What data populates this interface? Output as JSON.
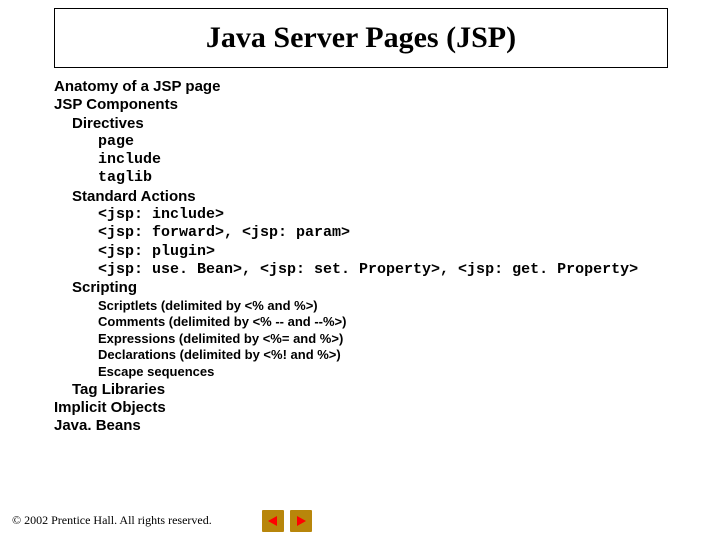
{
  "title": "Java Server Pages (JSP)",
  "outline": {
    "l1a": "Anatomy of a JSP page",
    "l1b": "JSP Components",
    "l2_directives": "Directives",
    "dir_page": "page",
    "dir_include": "include",
    "dir_taglib": "taglib",
    "l2_actions": "Standard Actions",
    "act_include": "<jsp: include>",
    "act_forward": "<jsp: forward>, <jsp: param>",
    "act_plugin": "<jsp: plugin>",
    "act_bean": "<jsp: use. Bean>, <jsp: set. Property>, <jsp: get. Property>",
    "l2_scripting": "Scripting",
    "scr_scriptlets": "Scriptlets (delimited by <% and %>)",
    "scr_comments": "Comments (delimited by <% -- and --%>)",
    "scr_expressions": "Expressions (delimited by <%= and %>)",
    "scr_declarations": "Declarations (delimited by <%! and %>)",
    "scr_escape": "Escape sequences",
    "l2_taglib": "Tag Libraries",
    "l1c": "Implicit Objects",
    "l1d": "Java. Beans"
  },
  "copyright": "© 2002 Prentice Hall.  All rights reserved."
}
